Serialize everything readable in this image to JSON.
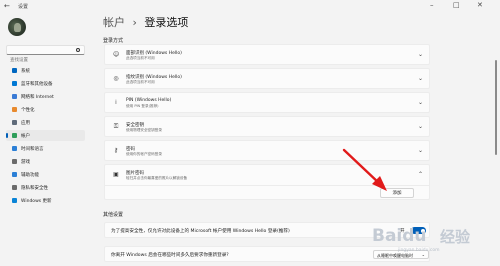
{
  "window": {
    "title": "设置",
    "back_icon": "back-arrow-icon",
    "controls": [
      "minimize-icon",
      "maximize-icon",
      "close-icon"
    ]
  },
  "search": {
    "placeholder": "查找设置"
  },
  "sidebar": {
    "items": [
      {
        "label": "系统",
        "icon": "system-icon",
        "color": "#0067c0"
      },
      {
        "label": "蓝牙和其他设备",
        "icon": "bluetooth-icon",
        "color": "#0078d4"
      },
      {
        "label": "网络和 Internet",
        "icon": "network-icon",
        "color": "#3a7bd5"
      },
      {
        "label": "个性化",
        "icon": "brush-icon",
        "color": "#e88a2e"
      },
      {
        "label": "应用",
        "icon": "apps-icon",
        "color": "#5f6b7a"
      },
      {
        "label": "帐户",
        "icon": "account-icon",
        "color": "#2e9e5a",
        "active": true
      },
      {
        "label": "时间和语言",
        "icon": "clock-language-icon",
        "color": "#2b7fd6"
      },
      {
        "label": "游戏",
        "icon": "game-icon",
        "color": "#6b6b6b"
      },
      {
        "label": "辅助功能",
        "icon": "accessibility-icon",
        "color": "#2b7fd6"
      },
      {
        "label": "隐私和安全性",
        "icon": "shield-icon",
        "color": "#6b6b6b"
      },
      {
        "label": "Windows 更新",
        "icon": "update-icon",
        "color": "#0a84d6"
      }
    ]
  },
  "breadcrumb": {
    "parent": "帐户",
    "separator": "›",
    "current": "登录选项"
  },
  "sign_in_methods": {
    "heading": "登录方式",
    "items": [
      {
        "title": "面部识别 (Windows Hello)",
        "subtitle": "此选项当前不可用",
        "icon": "face-icon"
      },
      {
        "title": "指纹识别 (Windows Hello)",
        "subtitle": "此选项当前不可用",
        "icon": "fingerprint-icon"
      },
      {
        "title": "PIN (Windows Hello)",
        "subtitle": "使用 PIN 登录(推荐)",
        "icon": "pin-icon"
      },
      {
        "title": "安全密钥",
        "subtitle": "使用物理安全密钥登录",
        "icon": "key-icon"
      },
      {
        "title": "密码",
        "subtitle": "使用你的帐户密码登录",
        "icon": "password-icon"
      }
    ],
    "expanded": {
      "title": "图片密码",
      "subtitle": "轻扫并点击你最喜爱的照片以解锁设备",
      "icon": "picture-icon",
      "add_label": "添加"
    }
  },
  "additional": {
    "heading": "其他设置",
    "hello_row": {
      "text": "为了提高安全性，仅允许对此设备上的 Microsoft 帐户使用 Windows Hello 登录(推荐)",
      "toggle_label": "开",
      "toggle_on": true
    },
    "away_row": {
      "text": "你离开 Windows 后会在哪些时间多久后要求你重新登录?",
      "value": "从睡眠中唤醒电脑时"
    }
  },
  "watermark": {
    "brand": "Baidu",
    "suffix": "经验",
    "url": "jingyan.baidu.com"
  },
  "accent_color": "#005fb8",
  "annotation_color": "#e11a1a"
}
